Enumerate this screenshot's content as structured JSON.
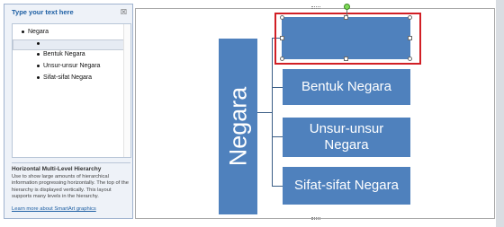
{
  "text_pane": {
    "title": "Type your text here",
    "close_glyph": "☒",
    "items": [
      {
        "label": "Negara",
        "level": 1
      },
      {
        "label": "",
        "level": 2
      },
      {
        "label": "Bentuk Negara",
        "level": 2
      },
      {
        "label": "Unsur-unsur Negara",
        "level": 2
      },
      {
        "label": "Sifat-sifat Negara",
        "level": 2
      }
    ],
    "description_title": "Horizontal Multi-Level Hierarchy",
    "description_body": "Use to show large amounts of hierarchical information progressing horizontally. The top of the hierarchy is displayed vertically. This layout supports many levels in the hierarchy.",
    "learn_more": "Learn more about SmartArt graphics"
  },
  "diagram": {
    "root": "Negara",
    "children": [
      "",
      "Bentuk Negara",
      "Unsur-unsur Negara",
      "Sifat-sifat Negara"
    ],
    "fill_color": "#4f81bd",
    "selection_color": "#d11f25"
  },
  "icons": {
    "close": "close-icon",
    "rotate": "rotate-handle-icon"
  }
}
